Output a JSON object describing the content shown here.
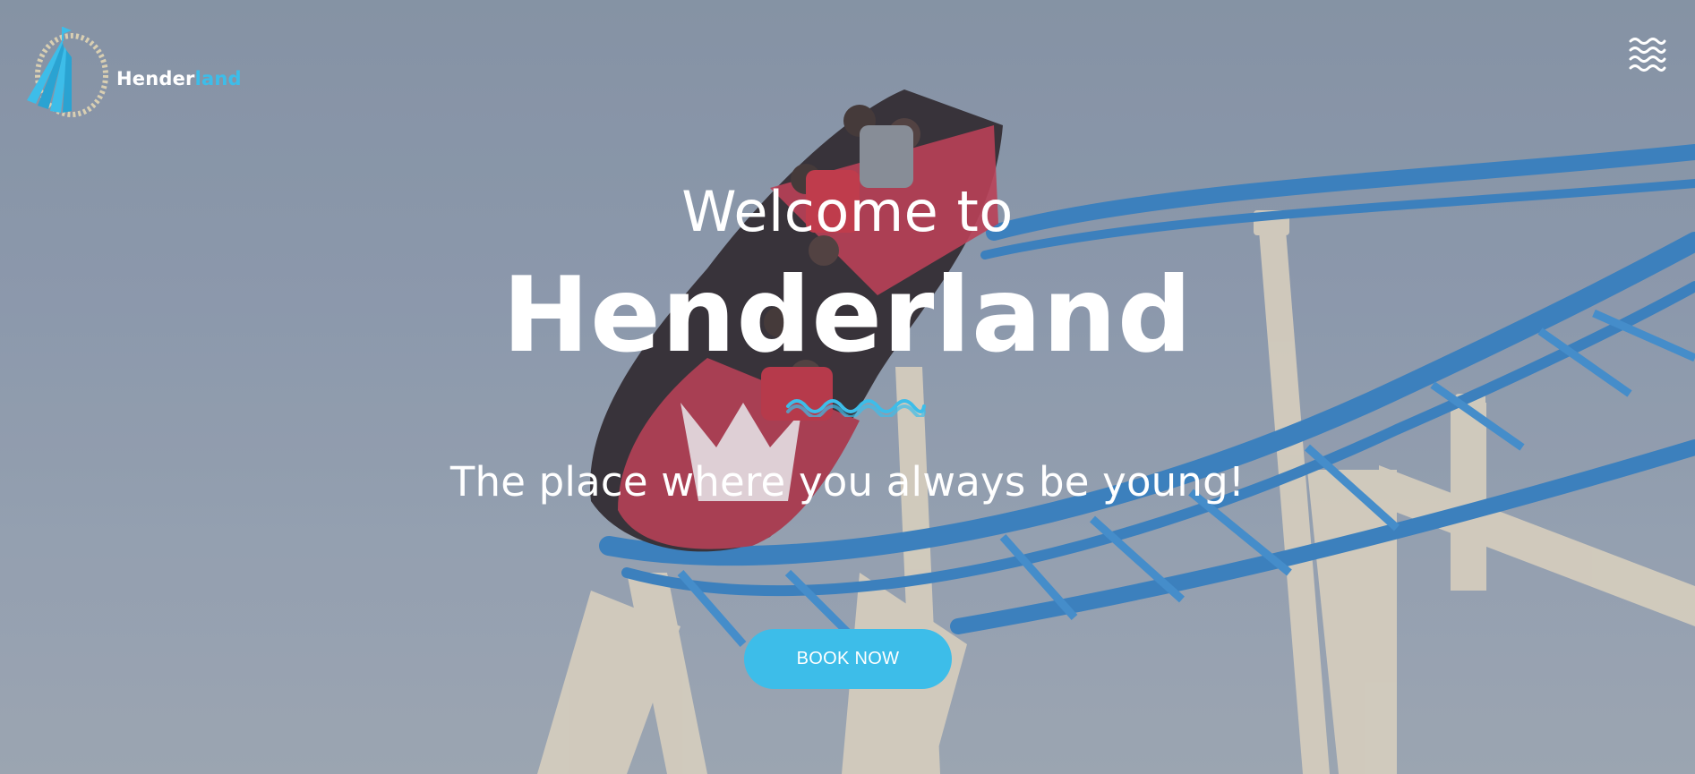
{
  "header": {
    "logo": {
      "text_primary": "Hender",
      "text_accent": "land",
      "icon": "carousel-tent-icon"
    },
    "menu": {
      "icon": "wave-menu-icon"
    }
  },
  "hero": {
    "welcome": "Welcome to",
    "title": "Henderland",
    "divider_icon": "wave-divider-icon",
    "tagline": "The place where you always be young!",
    "cta_label": "BOOK NOW",
    "background": "roller-coaster-photo"
  },
  "colors": {
    "accent": "#3dbde9",
    "text": "#ffffff",
    "track_blue": "#2f7fc6",
    "support_cream": "#e8dcc8"
  }
}
